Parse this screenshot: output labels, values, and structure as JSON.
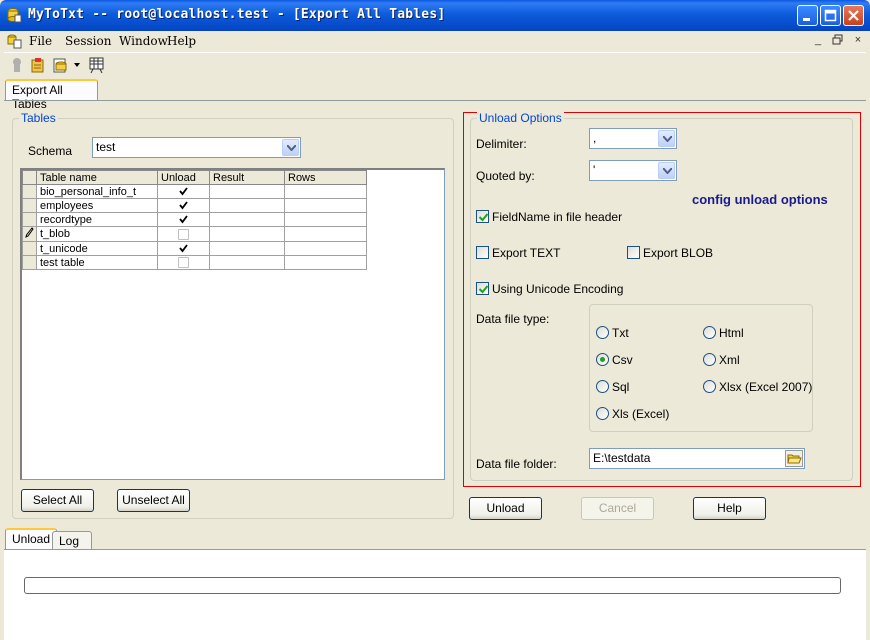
{
  "window": {
    "title": "MyToTxt -- root@localhost.test - [Export All Tables]",
    "minimize_glyph": "_",
    "maximize_glyph": "□",
    "close_glyph": "X"
  },
  "menu": [
    "File",
    "Session",
    "Window",
    "Help"
  ],
  "mdi_controls": [
    "_",
    "×"
  ],
  "doc_tab": "Export All Tables",
  "tables_group": {
    "label": "Tables",
    "schema_label": "Schema",
    "schema_value": "test",
    "columns": [
      "Table name",
      "Unload",
      "Result",
      "Rows"
    ],
    "rows": [
      {
        "name": "bio_personal_info_t",
        "unload": true,
        "editing": false
      },
      {
        "name": "employees",
        "unload": true,
        "editing": false
      },
      {
        "name": "recordtype",
        "unload": true,
        "editing": false
      },
      {
        "name": "t_blob",
        "unload": false,
        "editing": true
      },
      {
        "name": "t_unicode",
        "unload": true,
        "editing": false
      },
      {
        "name": "test table",
        "unload": false,
        "editing": false
      }
    ],
    "select_all": "Select All",
    "unselect_all": "Unselect All"
  },
  "unload_options": {
    "label": "Unload Options",
    "delimiter_label": "Delimiter:",
    "delimiter_value": ",",
    "quoted_by_label": "Quoted by:",
    "quoted_by_value": "'",
    "callout": "config unload options",
    "fieldname_header": {
      "label": "FieldName in file header",
      "checked": true
    },
    "export_text": {
      "label": "Export TEXT",
      "checked": false
    },
    "export_blob": {
      "label": "Export BLOB",
      "checked": false
    },
    "unicode": {
      "label": "Using Unicode Encoding",
      "checked": true
    },
    "data_file_type_label": "Data file type:",
    "file_types": {
      "txt": "Txt",
      "csv": "Csv",
      "sql": "Sql",
      "xls": "Xls (Excel)",
      "html": "Html",
      "xml": "Xml",
      "xlsx": "Xlsx (Excel 2007)"
    },
    "selected_type": "Csv",
    "folder_label": "Data file folder:",
    "folder_value": "E:\\testdata"
  },
  "actions": {
    "unload": "Unload",
    "cancel": "Cancel",
    "help": "Help"
  },
  "bottom_tabs": [
    "Unload",
    "Log"
  ],
  "progress": 0,
  "colors": {
    "accent": "#0046d5",
    "highlight": "#e00000",
    "callout": "#1a1a8c"
  }
}
